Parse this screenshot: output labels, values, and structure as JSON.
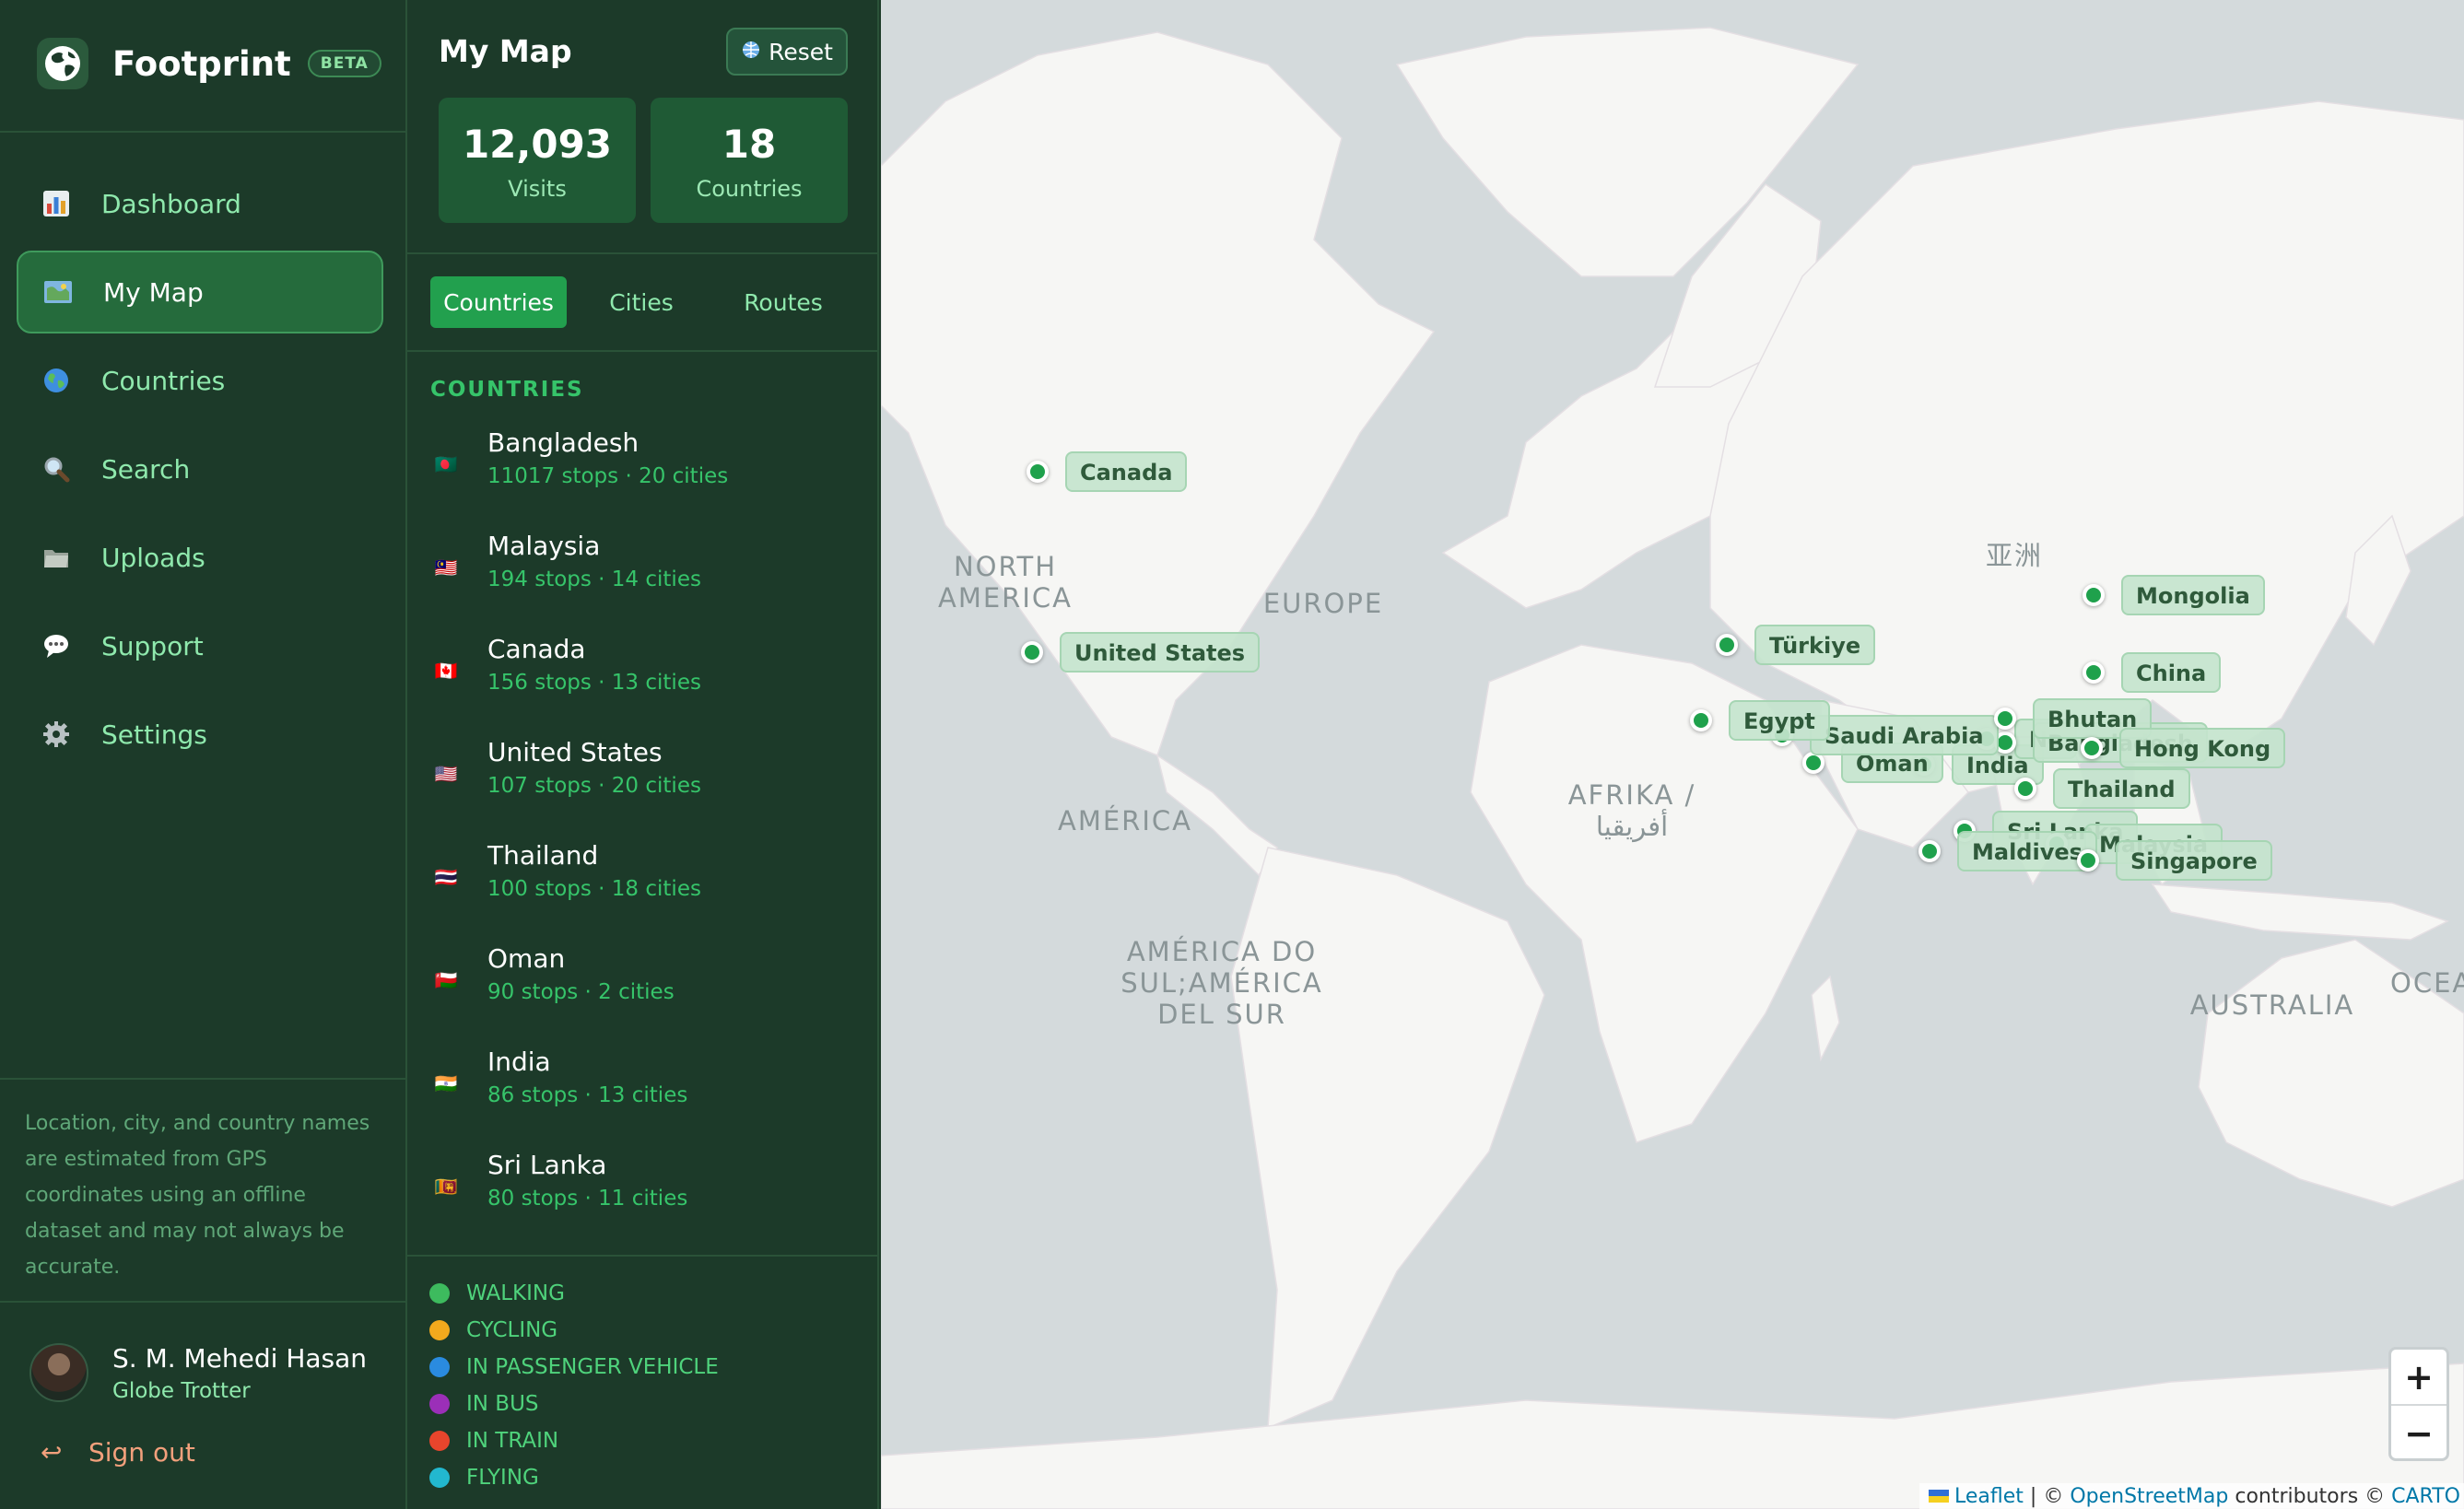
{
  "brand": {
    "name": "Footprint",
    "badge": "BETA"
  },
  "nav": [
    {
      "label": "Dashboard",
      "icon": "bar-chart-icon",
      "active": false
    },
    {
      "label": "My Map",
      "icon": "map-icon",
      "active": true
    },
    {
      "label": "Countries",
      "icon": "globe-icon",
      "active": false
    },
    {
      "label": "Search",
      "icon": "search-icon",
      "active": false
    },
    {
      "label": "Uploads",
      "icon": "folder-icon",
      "active": false
    },
    {
      "label": "Support",
      "icon": "speech-bubble-icon",
      "active": false
    },
    {
      "label": "Settings",
      "icon": "gear-icon",
      "active": false
    }
  ],
  "disclaimer": "Location, city, and country names are estimated from GPS coordinates using an offline dataset and may not always be accurate.",
  "user": {
    "name": "S. M. Mehedi Hasan",
    "role": "Globe Trotter"
  },
  "signout": {
    "label": "Sign out",
    "icon": "sign-out-arrow-icon"
  },
  "panel": {
    "title": "My Map",
    "reset_label": "Reset",
    "stats": [
      {
        "value": "12,093",
        "label": "Visits"
      },
      {
        "value": "18",
        "label": "Countries"
      }
    ],
    "tabs": [
      {
        "label": "Countries",
        "active": true
      },
      {
        "label": "Cities",
        "active": false
      },
      {
        "label": "Routes",
        "active": false
      }
    ],
    "section_heading": "COUNTRIES",
    "countries": [
      {
        "name": "Bangladesh",
        "meta": "11017 stops · 20 cities",
        "flag": "🇧🇩"
      },
      {
        "name": "Malaysia",
        "meta": "194 stops · 14 cities",
        "flag": "🇲🇾"
      },
      {
        "name": "Canada",
        "meta": "156 stops · 13 cities",
        "flag": "🇨🇦"
      },
      {
        "name": "United States",
        "meta": "107 stops · 20 cities",
        "flag": "🇺🇸"
      },
      {
        "name": "Thailand",
        "meta": "100 stops · 18 cities",
        "flag": "🇹🇭"
      },
      {
        "name": "Oman",
        "meta": "90 stops · 2 cities",
        "flag": "🇴🇲"
      },
      {
        "name": "India",
        "meta": "86 stops · 13 cities",
        "flag": "🇮🇳"
      },
      {
        "name": "Sri Lanka",
        "meta": "80 stops · 11 cities",
        "flag": "🇱🇰"
      }
    ],
    "legend": [
      {
        "label": "WALKING",
        "color": "#3dbb5e"
      },
      {
        "label": "CYCLING",
        "color": "#f2a91d"
      },
      {
        "label": "IN PASSENGER VEHICLE",
        "color": "#2a8be0"
      },
      {
        "label": "IN BUS",
        "color": "#9b2fb8"
      },
      {
        "label": "IN TRAIN",
        "color": "#e8452c"
      },
      {
        "label": "FLYING",
        "color": "#22b8cf"
      }
    ]
  },
  "map": {
    "region_labels": [
      "NORTH AMERICA",
      "EUROPE",
      "亚洲",
      "AMÉRICA",
      "AFRIKA / أفريقيا",
      "AMÉRICA DO SUL;AMÉRICA DEL SUR",
      "AUSTRALIA",
      "OCEA"
    ],
    "markers": [
      "Canada",
      "United States",
      "Türkiye",
      "Egypt",
      "Saudi Arabia",
      "Oman",
      "India",
      "Ne",
      "Bhutan",
      "Bangladesh",
      "Hong Kong",
      "Mongolia",
      "China",
      "Thailand",
      "Sri Lanka",
      "Maldives",
      "Malaysia",
      "Singapore"
    ],
    "zoom_in": "+",
    "zoom_out": "−",
    "attribution": {
      "leaflet": "Leaflet",
      "sep1": " | © ",
      "osm": "OpenStreetMap",
      "contrib": " contributors © ",
      "carto": "CARTO"
    }
  },
  "colors": {
    "sidebar_bg": "#1c3a29",
    "accent": "#22a04e",
    "marker": "#1fa14c",
    "map_bg": "#d4dadc",
    "land": "#f6f6f4"
  }
}
